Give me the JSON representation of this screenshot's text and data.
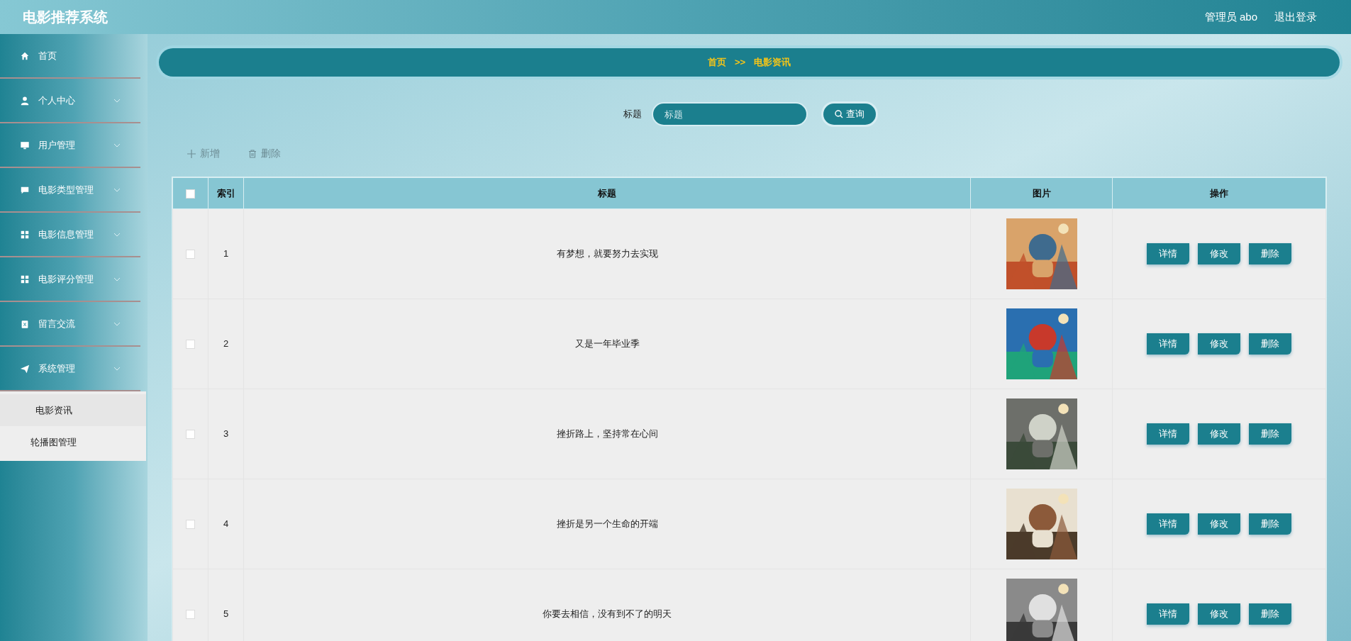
{
  "app_title": "电影推荐系统",
  "user": "管理员 abo",
  "logout": "退出登录",
  "sidebar": {
    "items": [
      {
        "label": "首页",
        "kind": "link"
      },
      {
        "label": "个人中心",
        "kind": "menu"
      },
      {
        "label": "用户管理",
        "kind": "menu"
      },
      {
        "label": "电影类型管理",
        "kind": "menu"
      },
      {
        "label": "电影信息管理",
        "kind": "menu"
      },
      {
        "label": "电影评分管理",
        "kind": "menu"
      },
      {
        "label": "留言交流",
        "kind": "menu"
      },
      {
        "label": "系统管理",
        "kind": "menu",
        "children": [
          {
            "label": "电影资讯",
            "selected": true
          },
          {
            "label": "轮播图管理",
            "selected": false
          }
        ]
      }
    ]
  },
  "breadcrumb": [
    "首页",
    ">>",
    "电影资讯"
  ],
  "search": {
    "label": "标题",
    "placeholder": "标题",
    "button": "查询"
  },
  "actions": [
    "新增",
    "删除"
  ],
  "table": {
    "columns": [
      "索引",
      "标题",
      "图片",
      "操作"
    ],
    "header_checked": false,
    "rows": [
      {
        "checked": false,
        "index": "1",
        "title": "有梦想，就要努力去实现",
        "buttons": [
          "详情",
          "修改",
          "删除"
        ]
      },
      {
        "checked": false,
        "index": "2",
        "title": "又是一年毕业季",
        "buttons": [
          "详情",
          "修改",
          "删除"
        ]
      },
      {
        "checked": false,
        "index": "3",
        "title": "挫折路上，坚持常在心间",
        "buttons": [
          "详情",
          "修改",
          "删除"
        ]
      },
      {
        "checked": false,
        "index": "4",
        "title": "挫折是另一个生命的开端",
        "buttons": [
          "详情",
          "修改",
          "删除"
        ]
      },
      {
        "checked": false,
        "index": "5",
        "title": "你要去相信，没有到不了的明天",
        "buttons": [
          "详情",
          "修改",
          "删除"
        ]
      }
    ]
  }
}
